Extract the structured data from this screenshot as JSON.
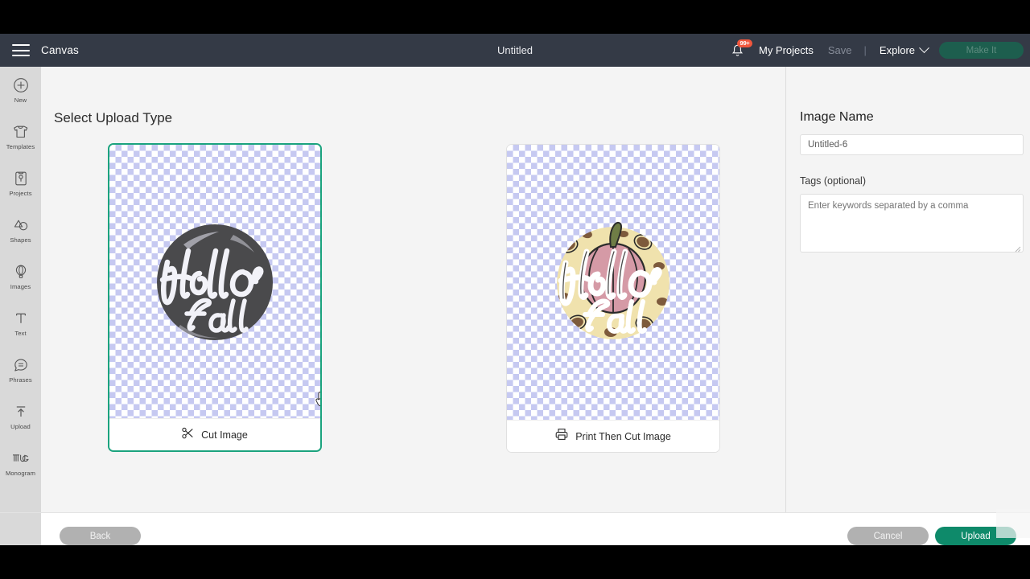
{
  "topnav": {
    "menu_icon": "hamburger-icon",
    "canvas_label": "Canvas",
    "document_title": "Untitled",
    "notification_icon": "bell-icon",
    "notification_badge": "99+",
    "my_projects_label": "My Projects",
    "save_label": "Save",
    "separator": "|",
    "explore_label": "Explore",
    "explore_chevron": "chevron-down-icon",
    "make_it_label": "Make It"
  },
  "sidebar": {
    "items": [
      {
        "label": "New",
        "icon": "plus-circle-icon"
      },
      {
        "label": "Templates",
        "icon": "shirt-icon"
      },
      {
        "label": "Projects",
        "icon": "clipboard-icon"
      },
      {
        "label": "Shapes",
        "icon": "shapes-icon"
      },
      {
        "label": "Images",
        "icon": "hot-air-balloon-icon"
      },
      {
        "label": "Text",
        "icon": "text-t-icon"
      },
      {
        "label": "Phrases",
        "icon": "speech-bubble-icon"
      },
      {
        "label": "Upload",
        "icon": "upload-arrow-icon"
      },
      {
        "label": "Monogram",
        "icon": "monogram-icon"
      }
    ]
  },
  "main": {
    "page_title": "Select Upload Type",
    "cards": [
      {
        "id": "cut-image",
        "label": "Cut Image",
        "icon": "scissors-icon",
        "selected": true,
        "artwork": "hello-fall-dark-circle"
      },
      {
        "id": "print-then-cut-image",
        "label": "Print Then Cut Image",
        "icon": "printer-icon",
        "selected": false,
        "artwork": "hello-fall-pink-pumpkin"
      }
    ]
  },
  "right_panel": {
    "image_name_title": "Image Name",
    "image_name_value": "Untitled-6",
    "tags_label": "Tags (optional)",
    "tags_value": "",
    "tags_placeholder": "Enter keywords separated by a comma"
  },
  "bottom_bar": {
    "back_label": "Back",
    "cancel_label": "Cancel",
    "upload_label": "Upload"
  },
  "colors": {
    "topnav_bg": "#343a46",
    "sidebar_bg": "#d9d9d9",
    "main_bg": "#f4f4f4",
    "accent_green": "#0e8a6a",
    "selected_border": "#1ba37e",
    "badge_red": "#f2573d",
    "disabled_gray": "#b1b1b1",
    "checker_lavender": "#c6c9f1"
  }
}
